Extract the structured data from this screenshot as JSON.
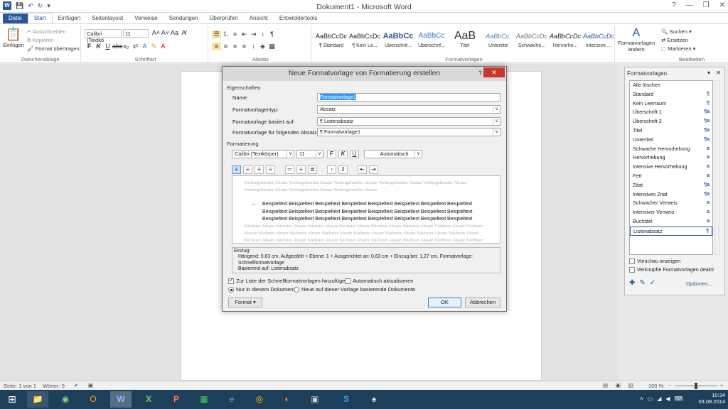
{
  "window": {
    "title": "Dokument1 - Microsoft Word",
    "controls": [
      "?",
      "—",
      "❐",
      "✕"
    ]
  },
  "tabs": [
    "Datei",
    "Start",
    "Einfügen",
    "Seitenlayout",
    "Verweise",
    "Sendungen",
    "Überprüfen",
    "Ansicht",
    "Entwicklertools"
  ],
  "ribbon": {
    "clipboard": {
      "paste": "Einfügen",
      "cut": "Ausschneiden",
      "copy": "Kopieren",
      "painter": "Format übertragen",
      "label": "Zwischenablage"
    },
    "font": {
      "name": "Calibri (Textkö",
      "size": "11",
      "label": "Schriftart"
    },
    "paragraph": {
      "label": "Absatz"
    },
    "styles": {
      "label": "Formatvorlagen",
      "items": [
        {
          "preview": "AaBbCcDc",
          "name": "¶ Standard"
        },
        {
          "preview": "AaBbCcDc",
          "name": "¶ Kein Le..."
        },
        {
          "preview": "AaBbCc",
          "name": "Überschrif..."
        },
        {
          "preview": "AaBbCc",
          "name": "Überschrif..."
        },
        {
          "preview": "AaB",
          "name": "Titel"
        },
        {
          "preview": "AaBbCc.",
          "name": "Untertitel"
        },
        {
          "preview": "AaBbCcDc",
          "name": "Schwache..."
        },
        {
          "preview": "AaBbCcDc",
          "name": "Hervorhe..."
        },
        {
          "preview": "AaBbCcDc",
          "name": "Intensive ..."
        }
      ],
      "change": "Formatvorlagen ändern"
    },
    "editing": {
      "find": "Suchen",
      "replace": "Ersetzen",
      "select": "Markieren",
      "label": "Bearbeiten"
    }
  },
  "dialog": {
    "title": "Neue Formatvorlage von Formatierung erstellen",
    "help": "?",
    "close": "✕",
    "properties": "Eigenschaften",
    "name_label": "Name:",
    "name_value": "Formatvorlage1",
    "type_label": "Formatvorlagentyp:",
    "type_value": "Absatz",
    "based_label": "Formatvorlage basiert auf:",
    "based_value": "¶  Listenabsatz",
    "next_label": "Formatvorlage für folgenden Absatz:",
    "next_value": "¶  Formatvorlage1",
    "formatting": "Formatierung",
    "font_value": "Calibri (Textkörper)",
    "size_value": "11",
    "color_value": "Automatisch",
    "preview_prev": "Vorhergehender Absatz Vorhergehender Absatz Vorhergehender Absatz Vorhergehender Absatz Vorhergehender Absatz Vorhergehender Absatz Vorhergehender Absatz Vorhergehender Absatz",
    "preview_bullet": "–",
    "preview_sample": "Beispieltext Beispieltext Beispieltext Beispieltext Beispieltext Beispieltext Beispieltext Beispieltext Beispieltext Beispieltext Beispieltext Beispieltext Beispieltext Beispieltext Beispieltext Beispieltext Beispieltext Beispieltext Beispieltext Beispieltext Beispieltext Beispieltext Beispieltext Beispieltext",
    "preview_next": "Nächster Absatz Nächster Absatz Nächster Absatz Nächster Absatz Nächster Absatz Nächster Absatz Nächster Absatz Nächster Absatz Nächster Absatz Nächster Absatz Nächster Absatz Nächster Absatz Nächster Absatz Nächster Absatz Nächster Absatz Nächster Absatz Nächster Absatz Nächster Absatz Nächster Absatz Nächster Absatz Nächster Absatz Nächster Absatz Nächster Absatz Nächster Absatz",
    "desc_line1": "Einzug:",
    "desc_line2": "Hängend:  0,63 cm, Aufgezählt + Ebene: 1 + Ausgerichtet an:  0,63 cm + Einzug bei:  1,27 cm, Formatvorlage: Schnellformatvorlage",
    "desc_line3": "Basierend auf: Listenabsatz",
    "add_quick": "Zur Liste der Schnellformatvorlagen hinzufügen",
    "auto_update": "Automatisch aktualisieren",
    "only_doc": "Nur in diesem Dokument",
    "new_docs": "Neue auf dieser Vorlage basierende Dokumente",
    "format_btn": "Format ▾",
    "ok": "OK",
    "cancel": "Abbrechen"
  },
  "styles_pane": {
    "title": "Formatvorlagen",
    "items": [
      {
        "name": "Alle löschen",
        "mark": ""
      },
      {
        "name": "Standard",
        "mark": "¶"
      },
      {
        "name": "Kein Leerraum",
        "mark": "¶"
      },
      {
        "name": "Überschrift 1",
        "mark": "¶a"
      },
      {
        "name": "Überschrift 2",
        "mark": "¶a"
      },
      {
        "name": "Titel",
        "mark": "¶a"
      },
      {
        "name": "Untertitel",
        "mark": "¶a"
      },
      {
        "name": "Schwache Hervorhebung",
        "mark": "a"
      },
      {
        "name": "Hervorhebung",
        "mark": "a"
      },
      {
        "name": "Intensive Hervorhebung",
        "mark": "a"
      },
      {
        "name": "Fett",
        "mark": "a"
      },
      {
        "name": "Zitat",
        "mark": "¶a"
      },
      {
        "name": "Intensives Zitat",
        "mark": "¶a"
      },
      {
        "name": "Schwacher Verweis",
        "mark": "a"
      },
      {
        "name": "Intensiver Verweis",
        "mark": "a"
      },
      {
        "name": "Buchtitel",
        "mark": "a"
      },
      {
        "name": "Listenabsatz",
        "mark": "¶"
      }
    ],
    "show_preview": "Vorschau anzeigen",
    "disable_linked": "Verknüpfte Formatvorlagen deakti",
    "options": "Optionen..."
  },
  "status": {
    "page": "Seite: 1 von 1",
    "words": "Wörter: 0",
    "zoom": "100 %"
  },
  "taskbar": {
    "time": "10:34",
    "date": "03.09.2014"
  }
}
